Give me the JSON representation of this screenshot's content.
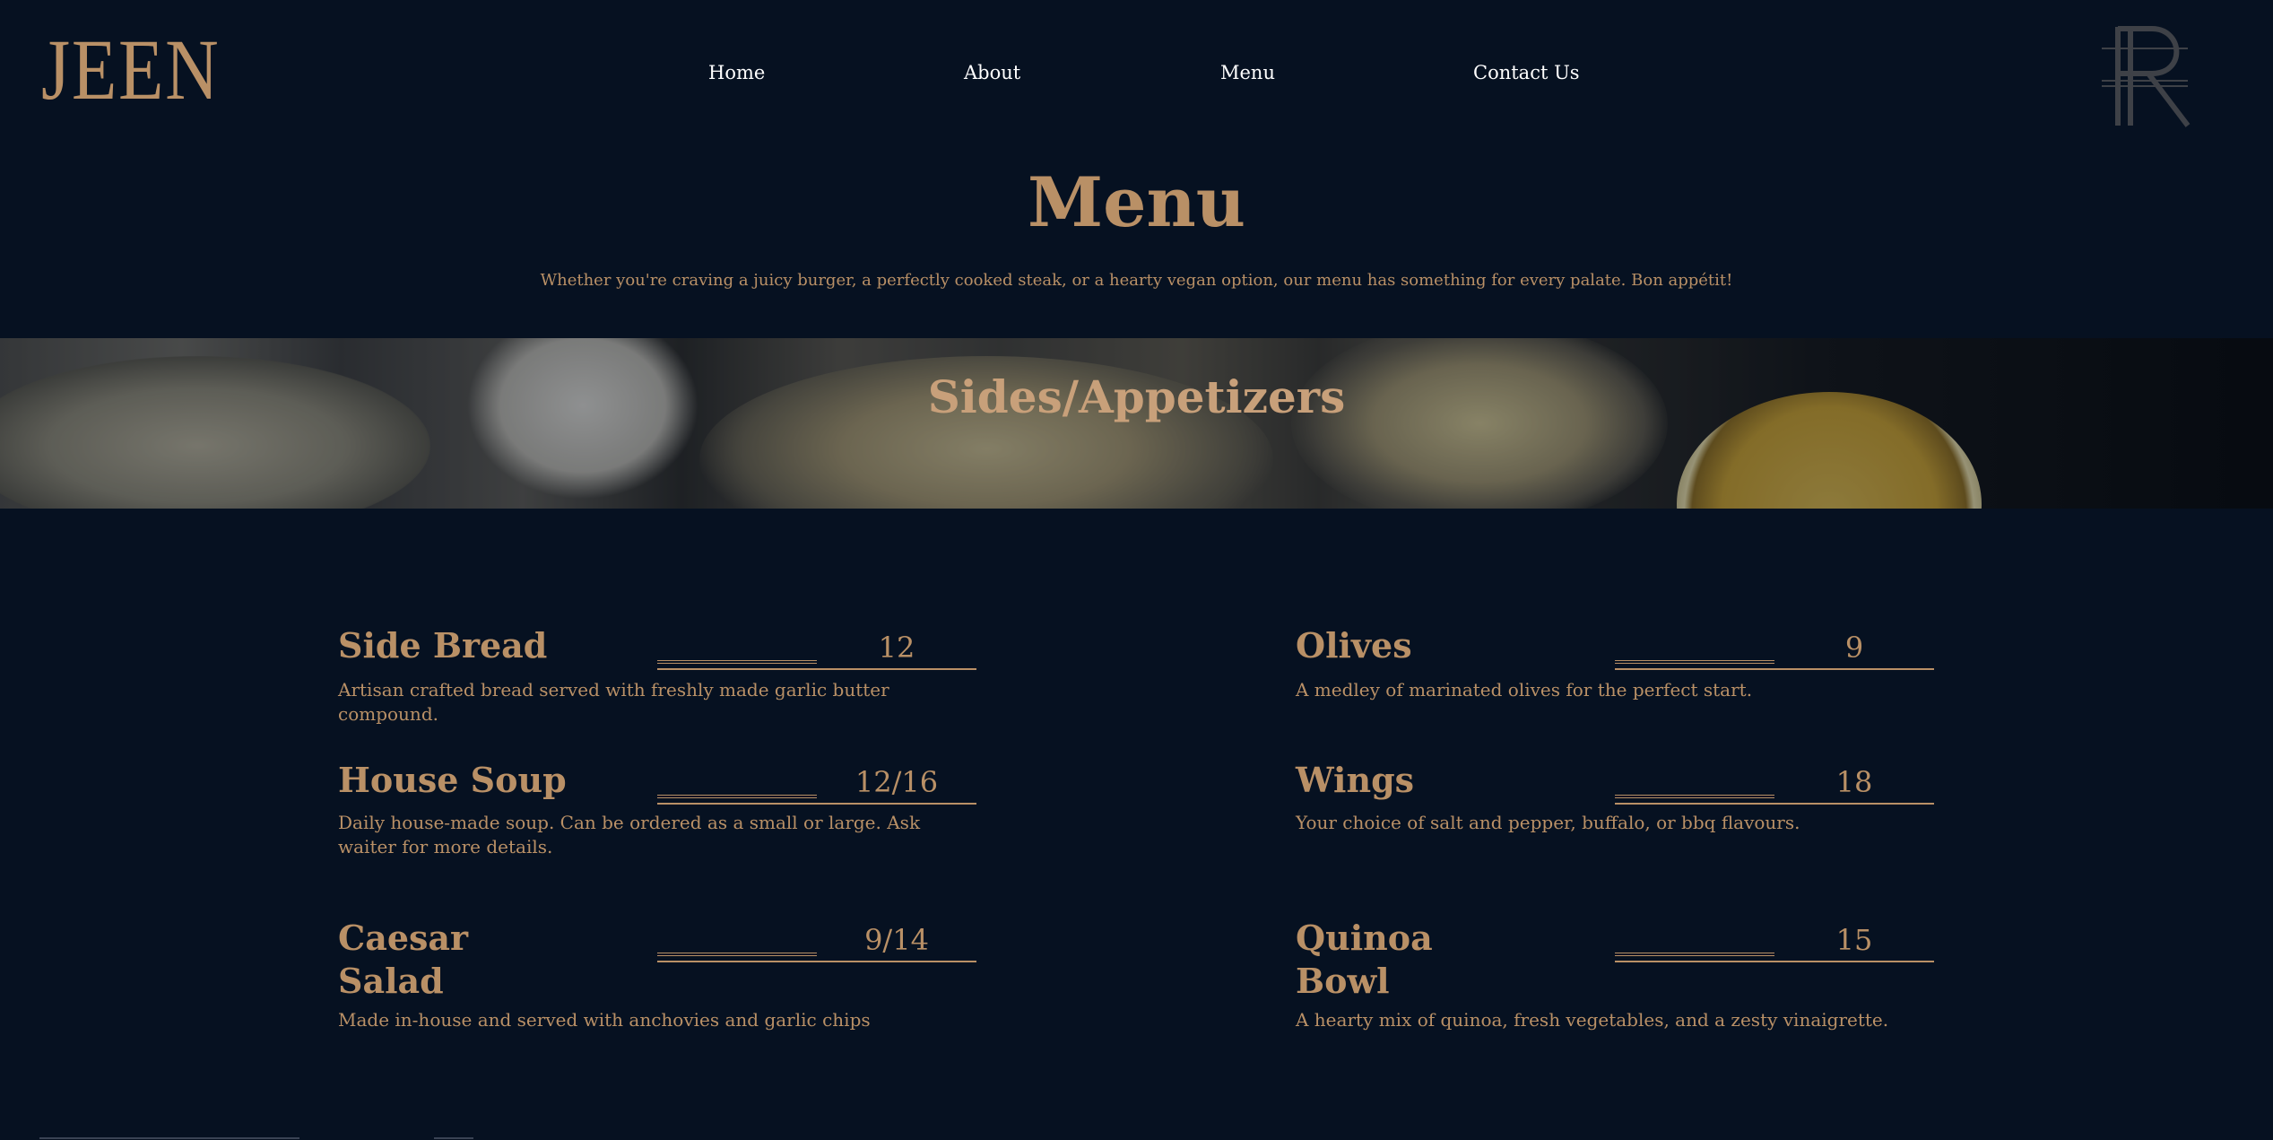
{
  "brand": {
    "logo_text": "JEEN",
    "monogram": "R"
  },
  "nav": {
    "items": [
      {
        "label": "Home"
      },
      {
        "label": "About"
      },
      {
        "label": "Menu"
      },
      {
        "label": "Contact Us"
      }
    ]
  },
  "page": {
    "title": "Menu",
    "subtitle": "Whether you're craving a juicy burger, a perfectly cooked steak, or a hearty vegan option, our menu has something for every palate. Bon appétit!"
  },
  "section": {
    "title": "Sides/Appetizers"
  },
  "menu_items": [
    {
      "name": "Side Bread",
      "price": "12",
      "description": "Artisan crafted bread served with freshly made garlic butter compound."
    },
    {
      "name": "Olives",
      "price": "9",
      "description": "A medley of marinated olives for the perfect start."
    },
    {
      "name": "House Soup",
      "price": "12/16",
      "description": "Daily house-made soup. Can be ordered as a small or large. Ask waiter for more details."
    },
    {
      "name": "Wings",
      "price": "18",
      "description": "Your choice of salt and pepper, buffalo, or bbq flavours."
    },
    {
      "name": "Caesar Salad",
      "price": "9/14",
      "description": "Made in-house and served with anchovies and garlic chips"
    },
    {
      "name": "Quinoa Bowl",
      "price": "15",
      "description": "A hearty mix of quinoa, fresh vegetables, and a zesty vinaigrette."
    }
  ],
  "colors": {
    "background": "#061121",
    "accent": "#b99066",
    "nav_text": "#ffffff"
  },
  "icons": {
    "banner_image": "oysters-lemon-photo"
  }
}
